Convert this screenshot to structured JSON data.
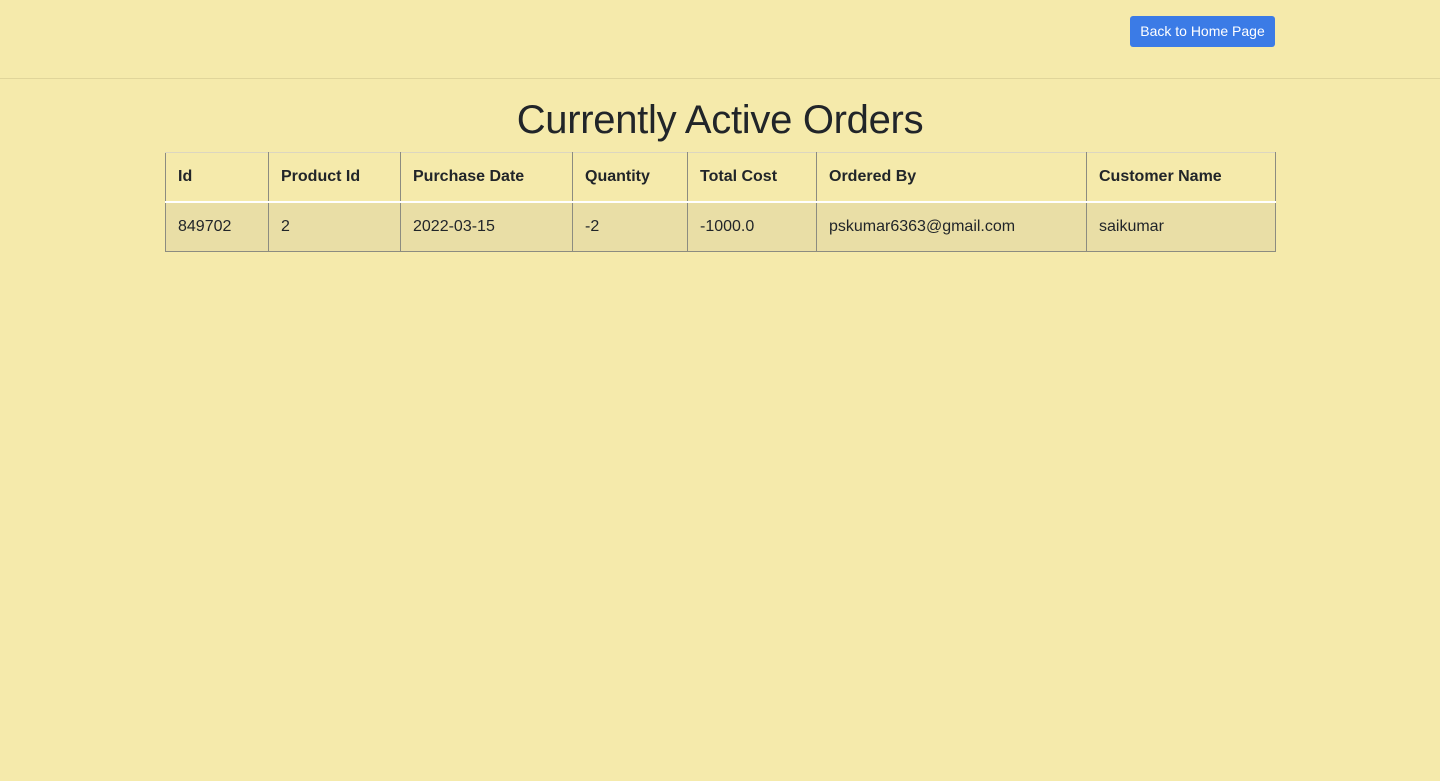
{
  "header": {
    "home_button_label": "Back to Home Page"
  },
  "page": {
    "title": "Currently Active Orders"
  },
  "table": {
    "columns": [
      "Id",
      "Product Id",
      "Purchase Date",
      "Quantity",
      "Total Cost",
      "Ordered By",
      "Customer Name"
    ],
    "rows": [
      [
        "849702",
        "2",
        "2022-03-15",
        "-2",
        "-1000.0",
        "pskumar6363@gmail.com",
        "saikumar"
      ]
    ]
  },
  "colors": {
    "background": "#f5eaab",
    "button": "#3b7be6",
    "row_background": "#e9dea6"
  }
}
